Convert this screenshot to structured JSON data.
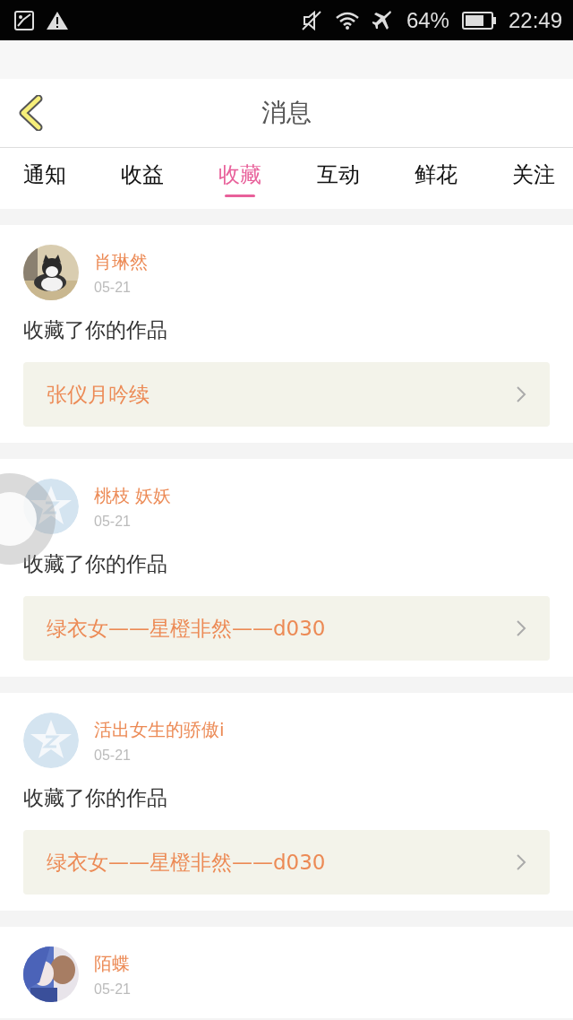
{
  "status_bar": {
    "battery": "64%",
    "time": "22:49"
  },
  "header": {
    "title": "消息"
  },
  "tabs": [
    {
      "label": "通知",
      "selected": false
    },
    {
      "label": "收益",
      "selected": false
    },
    {
      "label": "收藏",
      "selected": true
    },
    {
      "label": "互动",
      "selected": false
    },
    {
      "label": "鲜花",
      "selected": false
    },
    {
      "label": "关注",
      "selected": false
    }
  ],
  "messages": [
    {
      "name": "肖琳然",
      "date": "05-21",
      "action": "收藏了你的作品",
      "work": "张仪月吟续"
    },
    {
      "avatar": {
        "kind": "default"
      },
      "name": "桃枝 妖妖",
      "date": "05-21",
      "action": "收藏了你的作品",
      "work": "绿衣女——星橙非然——d030"
    },
    {
      "avatar": {
        "kind": "default"
      },
      "name": "活出女生的骄傲i",
      "date": "05-21",
      "action": "收藏了你的作品",
      "work": "绿衣女——星橙非然——d030"
    },
    {
      "name": "陌蝶",
      "date": "05-21"
    }
  ]
}
